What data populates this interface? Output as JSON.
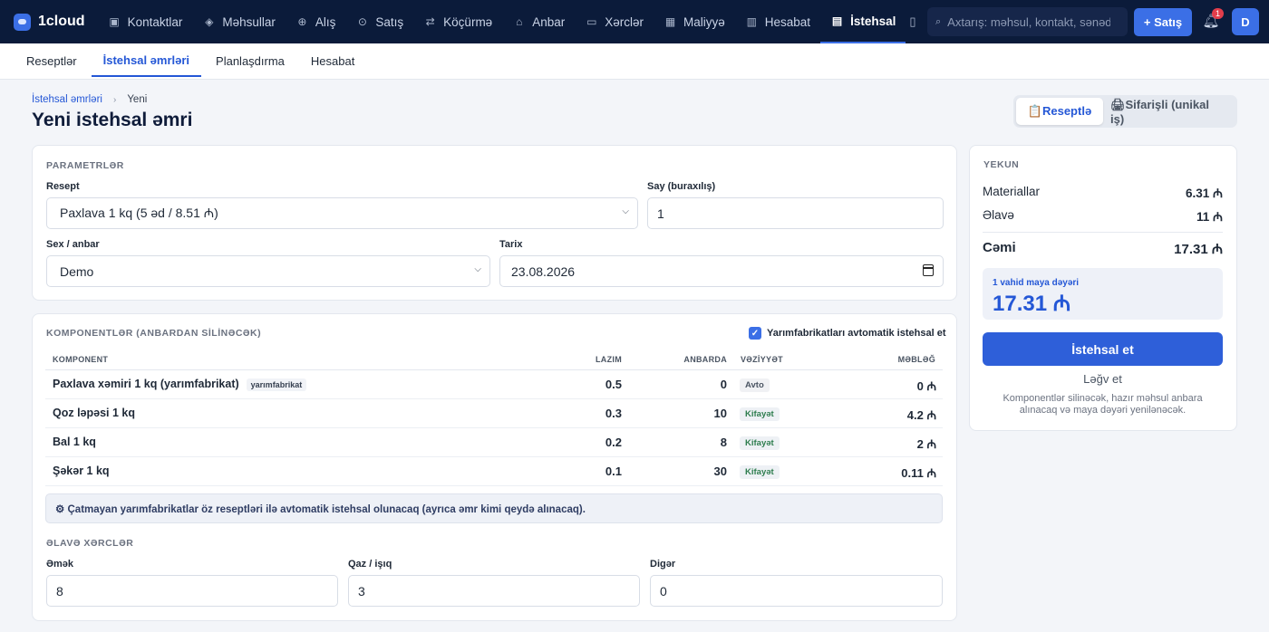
{
  "app": {
    "name": "1cloud"
  },
  "nav": [
    {
      "label": "Kontaktlar",
      "icon": "contacts-icon",
      "glyph": "▣"
    },
    {
      "label": "Məhsullar",
      "icon": "products-icon",
      "glyph": "◈"
    },
    {
      "label": "Alış",
      "icon": "purchase-icon",
      "glyph": "⊕"
    },
    {
      "label": "Satış",
      "icon": "sales-icon",
      "glyph": "⊙"
    },
    {
      "label": "Köçürmə",
      "icon": "transfer-icon",
      "glyph": "⇄"
    },
    {
      "label": "Anbar",
      "icon": "warehouse-icon",
      "glyph": "⌂"
    },
    {
      "label": "Xərclər",
      "icon": "expenses-icon",
      "glyph": "▭"
    },
    {
      "label": "Maliyyə",
      "icon": "finance-icon",
      "glyph": "▦"
    },
    {
      "label": "Hesabat",
      "icon": "report-icon",
      "glyph": "▥"
    },
    {
      "label": "İstehsal",
      "icon": "production-icon",
      "glyph": "▤",
      "active": true
    }
  ],
  "search": {
    "placeholder": "Axtarış: məhsul, kontakt, sənəd..."
  },
  "header": {
    "sale_button": "+ Satış",
    "notification_count": "1",
    "user_initial": "D"
  },
  "subtabs": [
    {
      "label": "Reseptlər"
    },
    {
      "label": "İstehsal əmrləri",
      "active": true
    },
    {
      "label": "Planlaşdırma"
    },
    {
      "label": "Hesabat"
    }
  ],
  "breadcrumb": {
    "parent": "İstehsal əmrləri",
    "current": "Yeni"
  },
  "page_title": "Yeni istehsal əmri",
  "mode": {
    "recipe": "📋Reseptlə",
    "custom": "🖨Sifarişli (unikal iş)"
  },
  "params": {
    "section": "PARAMETRLƏR",
    "recipe_label": "Resept",
    "recipe_value": "Paxlava 1 kq (5 əd / 8.51 ₼)",
    "qty_label": "Say (buraxılış)",
    "qty_value": "1",
    "warehouse_label": "Sex / anbar",
    "warehouse_value": "Demo",
    "date_label": "Tarix",
    "date_value": "23.08.2026"
  },
  "components": {
    "section": "KOMPONENTLƏR (ANBARDAN SİLİNƏCƏK)",
    "auto_label": "Yarımfabrikatları avtomatik istehsal et",
    "auto_checked": true,
    "headers": {
      "component": "KOMPONENT",
      "required": "LAZIM",
      "stock": "ANBARDA",
      "status": "VƏZİYYƏT",
      "amount": "MƏBLƏĞ"
    },
    "rows": [
      {
        "name": "Paxlava xəmiri 1 kq (yarımfabrikat)",
        "tag": "yarımfabrikat",
        "required": "0.5",
        "stock": "0",
        "status": "Avto",
        "status_type": "auto",
        "amount": "0 ₼"
      },
      {
        "name": "Qoz ləpəsi 1 kq",
        "tag": "",
        "required": "0.3",
        "stock": "10",
        "status": "Kifayət",
        "status_type": "ok",
        "amount": "4.2 ₼"
      },
      {
        "name": "Bal 1 kq",
        "tag": "",
        "required": "0.2",
        "stock": "8",
        "status": "Kifayət",
        "status_type": "ok",
        "amount": "2 ₼"
      },
      {
        "name": "Şəkər 1 kq",
        "tag": "",
        "required": "0.1",
        "stock": "30",
        "status": "Kifayət",
        "status_type": "ok",
        "amount": "0.11 ₼"
      }
    ],
    "info": "⚙ Çatmayan yarımfabrikatlar öz reseptləri ilə avtomatik istehsal olunacaq (ayrıca əmr kimi qeydə alınacaq)."
  },
  "extra": {
    "section": "ƏLAVƏ XƏRCLƏR",
    "labor_label": "Əmək",
    "labor_value": "8",
    "gas_label": "Qaz / işıq",
    "gas_value": "3",
    "other_label": "Digər",
    "other_value": "0"
  },
  "summary": {
    "section": "YEKUN",
    "materials_label": "Materiallar",
    "materials_value": "6.31 ₼",
    "extra_label": "Əlavə",
    "extra_value": "11 ₼",
    "total_label": "Cəmi",
    "total_value": "17.31 ₼",
    "unit_label": "1 vahid maya dəyəri",
    "unit_value": "17.31 ₼",
    "produce_button": "İstehsal et",
    "cancel_button": "Ləğv et",
    "note": "Komponentlər silinəcək, hazır məhsul anbara alınacaq və maya dəyəri yenilənəcək."
  },
  "colors": {
    "topbar": "#0b1b3a",
    "accent": "#3b6fe6",
    "primary_button": "#2e5fd9",
    "ok_status": "#2e7d4e"
  }
}
